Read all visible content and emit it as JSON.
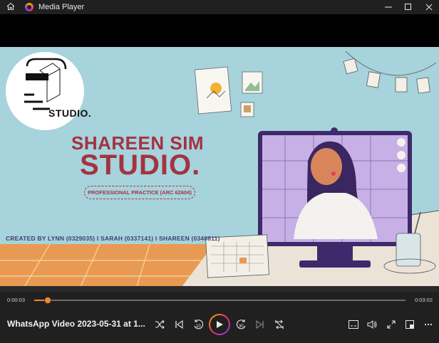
{
  "window": {
    "title": "Media Player"
  },
  "video": {
    "logo_text": "STUDIO.",
    "heading_line1": "SHAREEN SIM",
    "heading_line2": "STUDIO.",
    "course_pill": "PROFESSIONAL PRACTICE (ARC 62604)",
    "credits": "CREATED BY LYNN (0329035) I  SARAH (0337141) I SHAREEN (0340811)",
    "calendar_rows": 4,
    "calendar_cols": 4
  },
  "playback": {
    "current_time": "0:00:03",
    "total_time": "0:03:02",
    "progress_fraction": 0.017,
    "media_title": "WhatsApp Video 2023-05-31 at 1...",
    "skip_back_label": "10",
    "skip_forward_label": "30"
  },
  "colors": {
    "accent": "#f48a2c",
    "title_red": "#a33341",
    "background_teal": "#a6d3dc"
  }
}
